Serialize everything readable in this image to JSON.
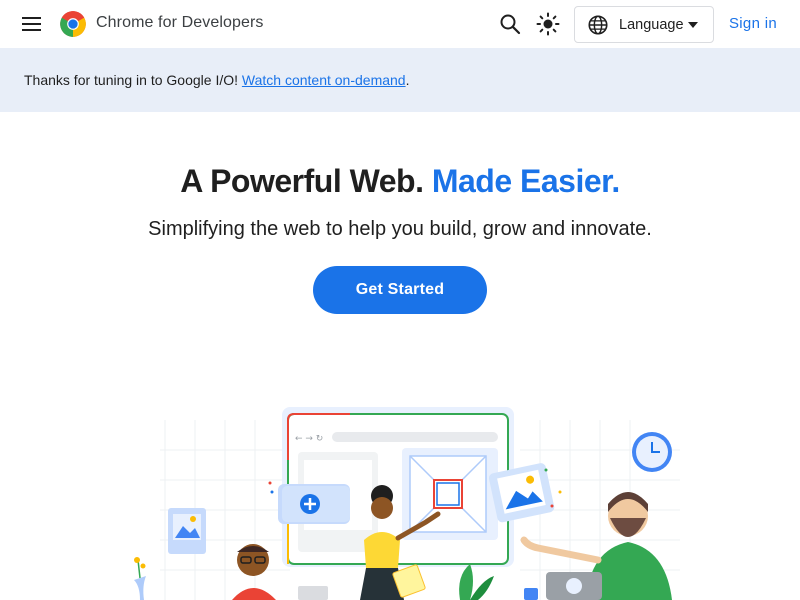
{
  "header": {
    "brand": "Chrome for Developers",
    "language_label": "Language",
    "signin_label": "Sign in",
    "icons": [
      "menu-icon",
      "chrome-logo-icon",
      "search-icon",
      "theme-toggle-icon",
      "globe-icon",
      "caret-down-icon"
    ]
  },
  "banner": {
    "text": "Thanks for tuning in to Google I/O!",
    "link_text": "Watch content on-demand",
    "suffix": "."
  },
  "hero": {
    "title_part1": "A Powerful Web.",
    "title_part2": "Made Easier.",
    "subtitle": "Simplifying the web to help you build, grow and innovate.",
    "cta_label": "Get Started"
  },
  "colors": {
    "accent": "#1a73e8",
    "banner_bg": "#e8eef8",
    "text": "#1f1f1f"
  }
}
